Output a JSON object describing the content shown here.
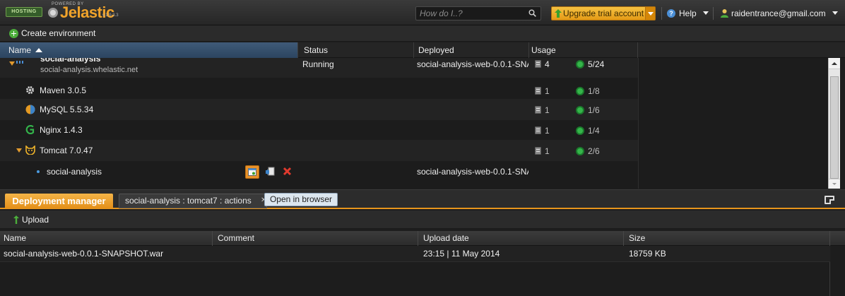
{
  "topbar": {
    "logo_badge": "HOSTING",
    "logo_powered": "POWERED BY",
    "logo_text": "Jelastic",
    "logo_version": "v.1.9.3.3",
    "search_placeholder": "How do I..?",
    "upgrade_label": "Upgrade trial account",
    "help_label": "Help",
    "user_label": "raidentrance@gmail.com"
  },
  "toolbar": {
    "create_label": "Create environment"
  },
  "env_grid": {
    "columns": [
      "Name",
      "Status",
      "Deployed",
      "Usage"
    ],
    "env": {
      "title": "social-analysis",
      "domain": "social-analysis.whelastic.net",
      "status": "Running",
      "deployed": "social-analysis-web-0.0.1-SNA",
      "cloudlets": "4",
      "nodes": "5/24"
    },
    "nodes": [
      {
        "name": "Maven 3.0.5",
        "cloudlets": "1",
        "count": "1/8",
        "icon": "maven-icon"
      },
      {
        "name": "MySQL 5.5.34",
        "cloudlets": "1",
        "count": "1/6",
        "icon": "mysql-icon"
      },
      {
        "name": "Nginx 1.4.3",
        "cloudlets": "1",
        "count": "1/4",
        "icon": "nginx-icon"
      },
      {
        "name": "Tomcat 7.0.47",
        "cloudlets": "1",
        "count": "2/6",
        "icon": "tomcat-icon"
      }
    ],
    "context": {
      "name": "social-analysis",
      "deployed": "social-analysis-web-0.0.1-SNA"
    }
  },
  "bottom_panel": {
    "tab_active": "Deployment manager",
    "tab_second": "social-analysis : tomcat7 : actions",
    "tooltip": "Open in browser",
    "upload_label": "Upload",
    "columns": [
      "Name",
      "Comment",
      "Upload date",
      "Size"
    ],
    "rows": [
      {
        "name": "social-analysis-web-0.0.1-SNAPSHOT.war",
        "comment": "",
        "date": "23:15 | 11 May 2014",
        "size": "18759 KB"
      }
    ]
  },
  "colors": {
    "accent_orange": "#e7951c",
    "header_blue": "#3f5a78",
    "node_green": "#35b54a",
    "delete_red": "#e03a2e"
  }
}
